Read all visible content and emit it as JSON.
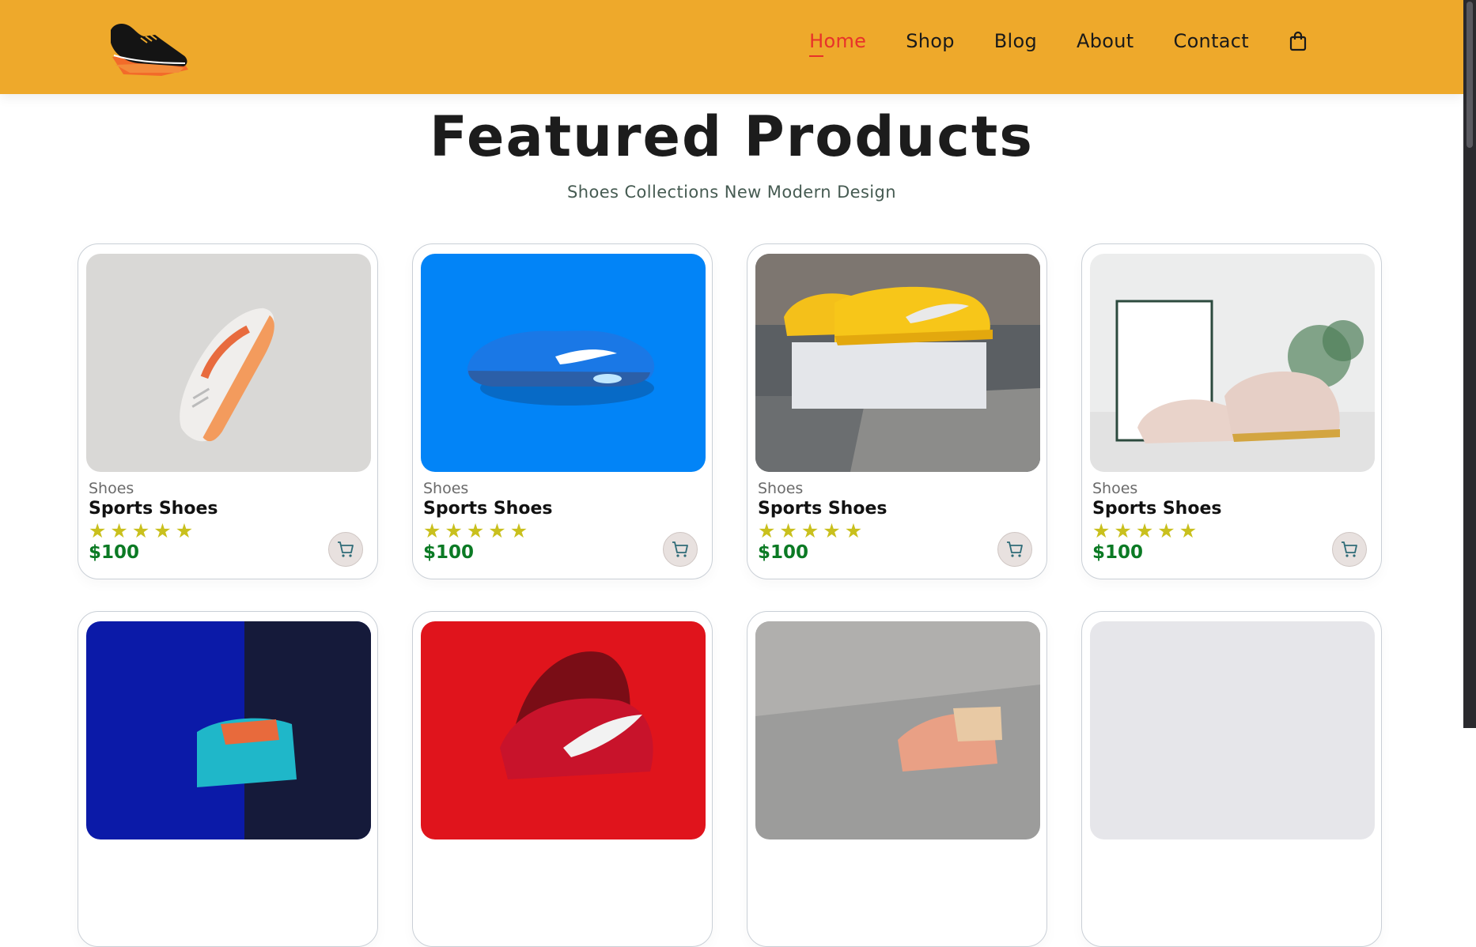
{
  "header": {
    "logo_icon": "sneaker-logo-icon",
    "nav": [
      {
        "label": "Home",
        "active": true
      },
      {
        "label": "Shop",
        "active": false
      },
      {
        "label": "Blog",
        "active": false
      },
      {
        "label": "About",
        "active": false
      },
      {
        "label": "Contact",
        "active": false
      }
    ],
    "cart_icon": "shopping-bag-icon"
  },
  "main": {
    "title": "Featured Products",
    "subtitle": "Shoes Collections New Modern Design"
  },
  "products": [
    {
      "brand": "Shoes",
      "name": "Sports Shoes",
      "rating": 5,
      "price": "$100"
    },
    {
      "brand": "Shoes",
      "name": "Sports Shoes",
      "rating": 5,
      "price": "$100"
    },
    {
      "brand": "Shoes",
      "name": "Sports Shoes",
      "rating": 5,
      "price": "$100"
    },
    {
      "brand": "Shoes",
      "name": "Sports Shoes",
      "rating": 5,
      "price": "$100"
    }
  ],
  "colors": {
    "header_bg": "#EEA92B",
    "active_nav": "#e8322a",
    "price": "#0b7a24",
    "star": "#c9c01d"
  }
}
